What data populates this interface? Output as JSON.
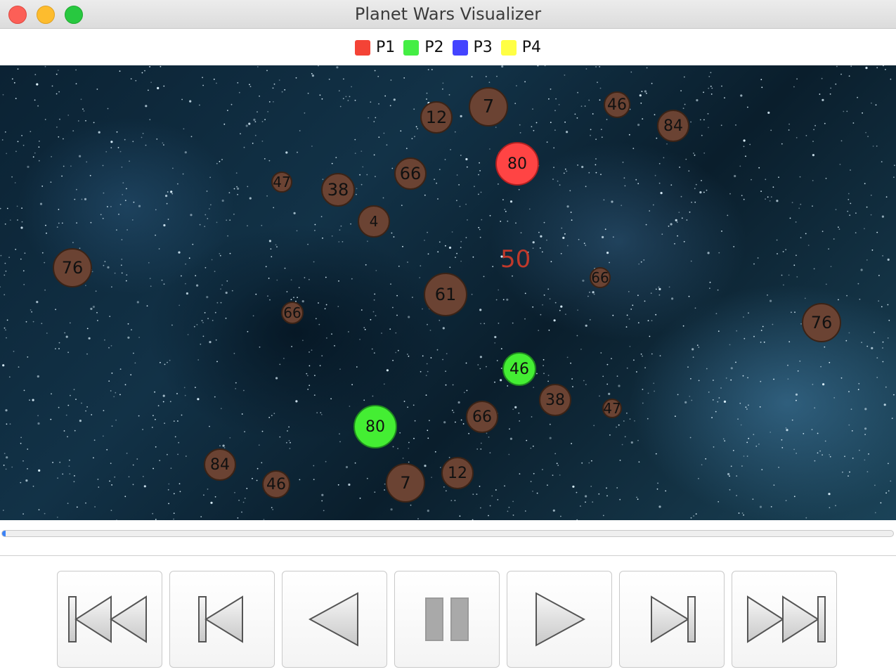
{
  "window": {
    "title": "Planet Wars Visualizer"
  },
  "legend": [
    {
      "label": "P1",
      "color": "#f44336"
    },
    {
      "label": "P2",
      "color": "#44ee44"
    },
    {
      "label": "P3",
      "color": "#4444ff"
    },
    {
      "label": "P4",
      "color": "#ffff44"
    }
  ],
  "colors": {
    "neutral": "#6b4333",
    "p1": "#ff4444",
    "p2": "#44ee33",
    "fleet": "#c0392b"
  },
  "planets": [
    {
      "value": "7",
      "owner": "neutral"
    },
    {
      "value": "12",
      "owner": "neutral"
    },
    {
      "value": "46",
      "owner": "neutral"
    },
    {
      "value": "84",
      "owner": "neutral"
    },
    {
      "value": "80",
      "owner": "p1"
    },
    {
      "value": "66",
      "owner": "neutral"
    },
    {
      "value": "47",
      "owner": "neutral"
    },
    {
      "value": "38",
      "owner": "neutral"
    },
    {
      "value": "4",
      "owner": "neutral"
    },
    {
      "value": "76",
      "owner": "neutral"
    },
    {
      "value": "61",
      "owner": "neutral"
    },
    {
      "value": "66",
      "owner": "neutral"
    },
    {
      "value": "66",
      "owner": "neutral"
    },
    {
      "value": "76",
      "owner": "neutral"
    },
    {
      "value": "46",
      "owner": "p2"
    },
    {
      "value": "38",
      "owner": "neutral"
    },
    {
      "value": "47",
      "owner": "neutral"
    },
    {
      "value": "66",
      "owner": "neutral"
    },
    {
      "value": "80",
      "owner": "p2"
    },
    {
      "value": "84",
      "owner": "neutral"
    },
    {
      "value": "46",
      "owner": "neutral"
    },
    {
      "value": "7",
      "owner": "neutral"
    },
    {
      "value": "12",
      "owner": "neutral"
    }
  ],
  "fleet": {
    "value": "50"
  },
  "progress": {
    "fraction": 0.003
  },
  "controls": [
    {
      "name": "skip-to-start",
      "icon": "skip-to-start-icon"
    },
    {
      "name": "step-back",
      "icon": "step-back-icon"
    },
    {
      "name": "play-backward",
      "icon": "play-backward-icon"
    },
    {
      "name": "pause",
      "icon": "pause-icon"
    },
    {
      "name": "play",
      "icon": "play-icon"
    },
    {
      "name": "step-forward",
      "icon": "step-forward-icon"
    },
    {
      "name": "skip-to-end",
      "icon": "skip-to-end-icon"
    }
  ]
}
